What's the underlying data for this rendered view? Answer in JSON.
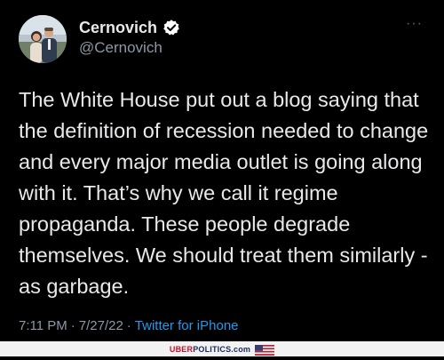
{
  "tweet": {
    "display_name": "Cernovich",
    "handle": "@Cernovich",
    "more_label": "···",
    "text": "The White House put out a blog saying that the definition of recession needed to change and every major media outlet is going along with it. That’s why we call it regime propaganda. These people degrade themselves. We should treat them similarly - as garbage.",
    "time": "7:11 PM",
    "separator_1": "·",
    "date": "7/27/22",
    "separator_2": "·",
    "source": "Twitter for iPhone"
  },
  "watermark": {
    "brand_red": "UBER",
    "brand_rest": "POLITICS.com"
  },
  "colors": {
    "background": "#000000",
    "text": "#e7e9ea",
    "secondary": "#8b98a5",
    "link": "#1d9bf0",
    "verified": "#ffffff",
    "watermark_red": "#c8102e",
    "watermark_navy": "#1a2a5a"
  },
  "icons": {
    "verified": "verified-badge-icon",
    "flag": "us-flag-icon"
  }
}
